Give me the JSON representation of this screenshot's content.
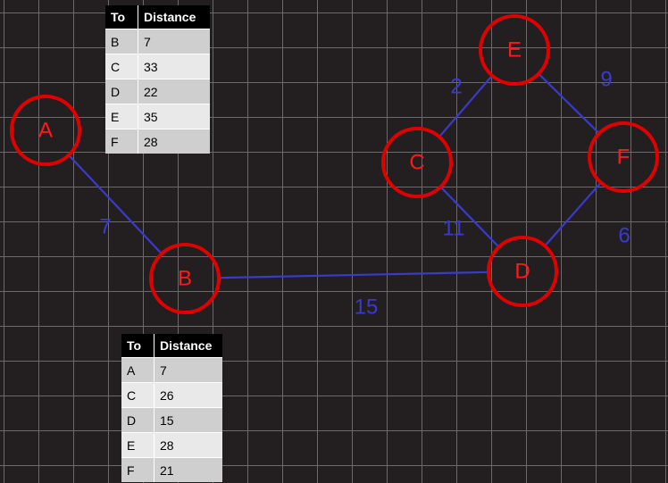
{
  "graph": {
    "nodes": [
      {
        "id": "A",
        "label": "A"
      },
      {
        "id": "B",
        "label": "B"
      },
      {
        "id": "C",
        "label": "C"
      },
      {
        "id": "D",
        "label": "D"
      },
      {
        "id": "E",
        "label": "E"
      },
      {
        "id": "F",
        "label": "F"
      }
    ],
    "edges": [
      {
        "from": "A",
        "to": "B",
        "weight": "7"
      },
      {
        "from": "B",
        "to": "D",
        "weight": "15"
      },
      {
        "from": "C",
        "to": "E",
        "weight": "2"
      },
      {
        "from": "E",
        "to": "F",
        "weight": "9"
      },
      {
        "from": "C",
        "to": "D",
        "weight": "11"
      },
      {
        "from": "D",
        "to": "F",
        "weight": "6"
      }
    ],
    "colors": {
      "node": "#e00000",
      "edge": "#3a3acb",
      "background": "#231f20",
      "grid": "#6a6a6a"
    }
  },
  "tables": [
    {
      "headers": [
        "To",
        "Distance"
      ],
      "rows": [
        [
          "B",
          "7"
        ],
        [
          "C",
          "33"
        ],
        [
          "D",
          "22"
        ],
        [
          "E",
          "35"
        ],
        [
          "F",
          "28"
        ]
      ]
    },
    {
      "headers": [
        "To",
        "Distance"
      ],
      "rows": [
        [
          "A",
          "7"
        ],
        [
          "C",
          "26"
        ],
        [
          "D",
          "15"
        ],
        [
          "E",
          "28"
        ],
        [
          "F",
          "21"
        ]
      ]
    }
  ]
}
